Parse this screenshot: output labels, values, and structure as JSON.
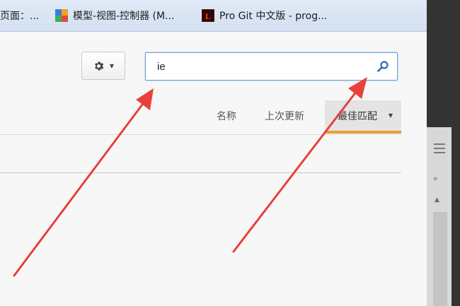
{
  "bookmarks": [
    {
      "label": "页面：...",
      "icon": "page-icon"
    },
    {
      "label": "模型-视图-控制器 (M...",
      "icon": "colorful-grid-icon"
    },
    {
      "label": "Pro Git 中文版 - prog...",
      "icon": "progit-logo-icon",
      "icon_text": "L"
    }
  ],
  "toolbar": {
    "settings_icon": "gear-icon"
  },
  "search": {
    "value": "ie",
    "icon": "search-icon"
  },
  "sort": {
    "name_label": "名称",
    "updated_label": "上次更新",
    "best_match_label": "最佳匹配",
    "active": "best_match"
  },
  "colors": {
    "accent_underline": "#ed9b32",
    "annotation_arrow": "#e8413b",
    "search_border": "#6aa0d6"
  }
}
